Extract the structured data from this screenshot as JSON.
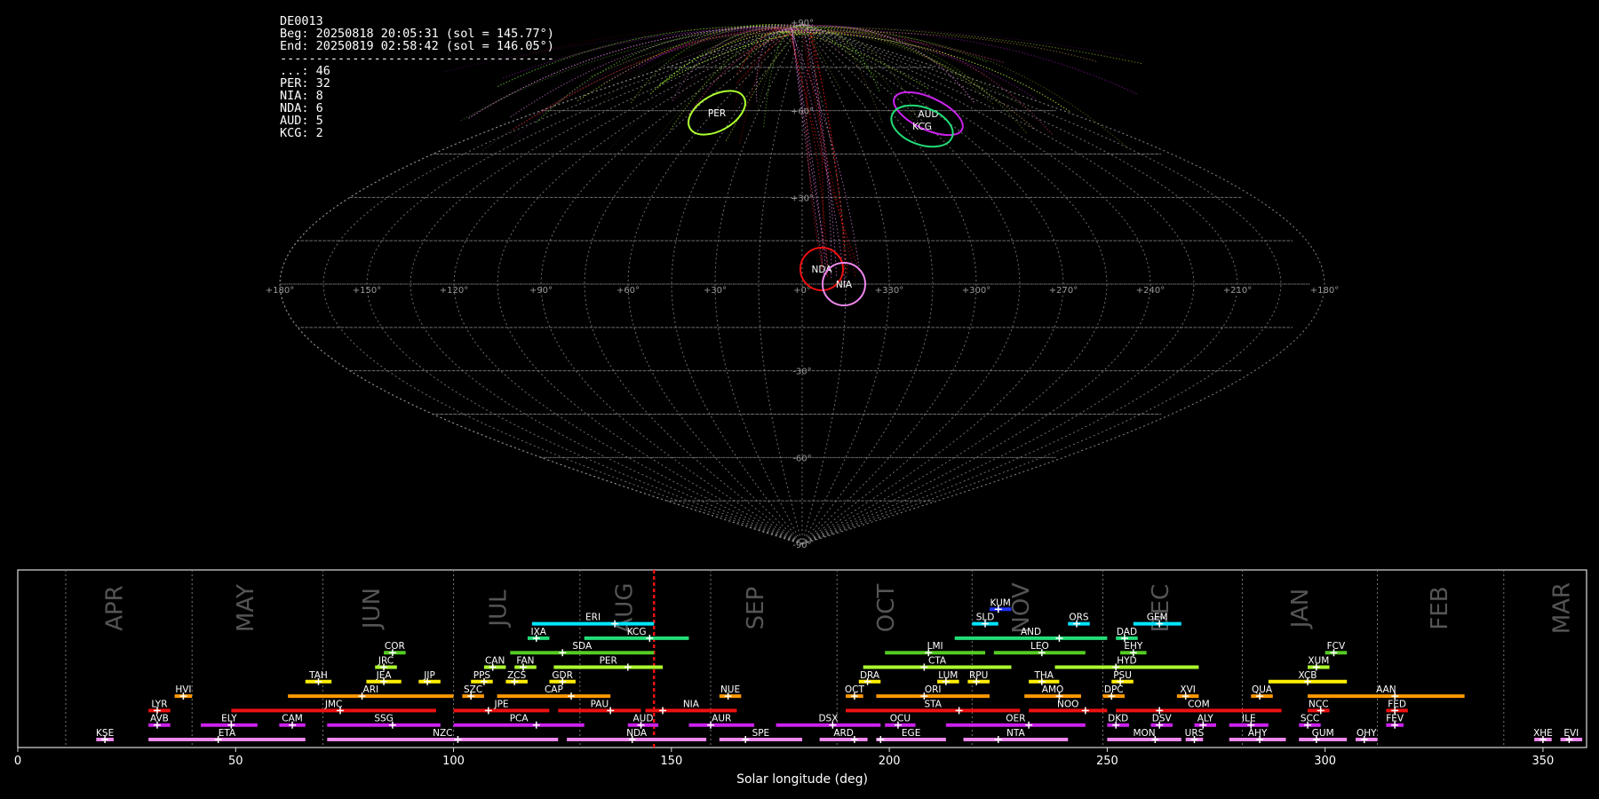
{
  "stats": {
    "camera": "DE0013",
    "begin": "Beg: 20250818 20:05:31 (sol = 145.77°)",
    "end": "End: 20250819 02:58:42 (sol = 146.05°)",
    "separator": "--------------------------------------",
    "counts": [
      {
        "code": "...",
        "n": 46
      },
      {
        "code": "PER",
        "n": 32
      },
      {
        "code": "NIA",
        "n": 8
      },
      {
        "code": "NDA",
        "n": 6
      },
      {
        "code": "AUD",
        "n": 5
      },
      {
        "code": "KCG",
        "n": 2
      }
    ]
  },
  "sky_map": {
    "lon_labels": [
      "+180°",
      "+150°",
      "+120°",
      "+90°",
      "+60°",
      "+30°",
      "+0°",
      "+330°",
      "+300°",
      "+270°",
      "+240°",
      "+210°",
      "+180°"
    ],
    "lat_labels": [
      "+90°",
      "+60°",
      "+30°",
      "-30°",
      "-60°",
      "-90°"
    ],
    "radiants": [
      {
        "code": "PER",
        "lon": 47,
        "lat": 58,
        "color": "#adff2f"
      },
      {
        "code": "AUD",
        "lon": 290,
        "lat": 59,
        "color": "#cc22ee"
      },
      {
        "code": "KCG",
        "lon": 286,
        "lat": 54,
        "color": "#22dd77"
      },
      {
        "code": "NDA",
        "lon": 335,
        "lat": -1,
        "color": "#ee1111"
      },
      {
        "code": "NIA",
        "lon": 323,
        "lat": -3,
        "color": "#ee88ee"
      }
    ]
  },
  "timeline": {
    "xlabel": "Solar longitude (deg)",
    "xticks": [
      0,
      50,
      100,
      150,
      200,
      250,
      300,
      350
    ],
    "xlim": [
      0,
      360
    ],
    "current_sol": 146,
    "months": [
      {
        "name": "APR",
        "pos": 24
      },
      {
        "name": "MAY",
        "pos": 54
      },
      {
        "name": "JUN",
        "pos": 83
      },
      {
        "name": "JUL",
        "pos": 112
      },
      {
        "name": "AUG",
        "pos": 141
      },
      {
        "name": "SEP",
        "pos": 171
      },
      {
        "name": "OCT",
        "pos": 201
      },
      {
        "name": "NOV",
        "pos": 232
      },
      {
        "name": "DEC",
        "pos": 264
      },
      {
        "name": "JAN",
        "pos": 296
      },
      {
        "name": "FEB",
        "pos": 328
      },
      {
        "name": "MAR",
        "pos": 356
      }
    ],
    "month_lines": [
      11,
      40,
      70,
      100,
      129,
      159,
      188,
      219,
      249,
      281,
      312,
      341
    ],
    "showers": [
      {
        "code": "KUM",
        "start": 223,
        "end": 228,
        "peak": 225,
        "row": 9,
        "color": "#2233ff"
      },
      {
        "code": "ERI",
        "start": 118,
        "end": 146,
        "peak": 137,
        "row": 8,
        "color": "#00e5ff"
      },
      {
        "code": "SLD",
        "start": 219,
        "end": 225,
        "peak": 222,
        "row": 8,
        "color": "#00e5ff"
      },
      {
        "code": "ORS",
        "start": 241,
        "end": 246,
        "peak": 243,
        "row": 8,
        "color": "#00e5ff"
      },
      {
        "code": "GEM",
        "start": 256,
        "end": 267,
        "peak": 262,
        "row": 8,
        "color": "#00e5ff"
      },
      {
        "code": "IXA",
        "start": 117,
        "end": 122,
        "peak": 119,
        "row": 7,
        "color": "#22dd77"
      },
      {
        "code": "KCG",
        "start": 130,
        "end": 154,
        "peak": 145,
        "row": 7,
        "color": "#22dd77"
      },
      {
        "code": "AND",
        "start": 215,
        "end": 250,
        "peak": 239,
        "row": 7,
        "color": "#22dd77"
      },
      {
        "code": "DAD",
        "start": 252,
        "end": 257,
        "peak": 254,
        "row": 7,
        "color": "#22dd77"
      },
      {
        "code": "COR",
        "start": 84,
        "end": 89,
        "peak": 86,
        "row": 6,
        "color": "#55cc22"
      },
      {
        "code": "SDA",
        "start": 113,
        "end": 146,
        "peak": 125,
        "row": 6,
        "color": "#55cc22"
      },
      {
        "code": "LMI",
        "start": 199,
        "end": 222,
        "peak": 209,
        "row": 6,
        "color": "#55cc22"
      },
      {
        "code": "LEO",
        "start": 224,
        "end": 245,
        "peak": 235,
        "row": 6,
        "color": "#55cc22"
      },
      {
        "code": "EHY",
        "start": 253,
        "end": 259,
        "peak": 256,
        "row": 6,
        "color": "#55cc22"
      },
      {
        "code": "FCV",
        "start": 300,
        "end": 305,
        "peak": 302,
        "row": 6,
        "color": "#55cc22"
      },
      {
        "code": "JRC",
        "start": 82,
        "end": 87,
        "peak": 84,
        "row": 5,
        "color": "#adff2f"
      },
      {
        "code": "CAN",
        "start": 107,
        "end": 112,
        "peak": 109,
        "row": 5,
        "color": "#adff2f"
      },
      {
        "code": "FAN",
        "start": 114,
        "end": 119,
        "peak": 116,
        "row": 5,
        "color": "#adff2f"
      },
      {
        "code": "PER",
        "start": 123,
        "end": 148,
        "peak": 140,
        "row": 5,
        "color": "#adff2f"
      },
      {
        "code": "CTA",
        "start": 194,
        "end": 228,
        "peak": 208,
        "row": 5,
        "color": "#adff2f"
      },
      {
        "code": "HYD",
        "start": 238,
        "end": 271,
        "peak": 252,
        "row": 5,
        "color": "#adff2f"
      },
      {
        "code": "XUM",
        "start": 296,
        "end": 301,
        "peak": 298,
        "row": 5,
        "color": "#adff2f"
      },
      {
        "code": "TAH",
        "start": 66,
        "end": 72,
        "peak": 69,
        "row": 4,
        "color": "#ffee00"
      },
      {
        "code": "JEA",
        "start": 80,
        "end": 88,
        "peak": 84,
        "row": 4,
        "color": "#ffee00"
      },
      {
        "code": "JIP",
        "start": 92,
        "end": 97,
        "peak": 94,
        "row": 4,
        "color": "#ffee00"
      },
      {
        "code": "PPS",
        "start": 104,
        "end": 109,
        "peak": 107,
        "row": 4,
        "color": "#ffee00"
      },
      {
        "code": "ZCS",
        "start": 112,
        "end": 117,
        "peak": 114,
        "row": 4,
        "color": "#ffee00"
      },
      {
        "code": "GDR",
        "start": 122,
        "end": 128,
        "peak": 125,
        "row": 4,
        "color": "#ffee00"
      },
      {
        "code": "DRA",
        "start": 193,
        "end": 198,
        "peak": 195,
        "row": 4,
        "color": "#ffee00"
      },
      {
        "code": "LUM",
        "start": 211,
        "end": 216,
        "peak": 213,
        "row": 4,
        "color": "#ffee00"
      },
      {
        "code": "RPU",
        "start": 218,
        "end": 223,
        "peak": 220,
        "row": 4,
        "color": "#ffee00"
      },
      {
        "code": "THA",
        "start": 232,
        "end": 239,
        "peak": 235,
        "row": 4,
        "color": "#ffee00"
      },
      {
        "code": "PSU",
        "start": 251,
        "end": 256,
        "peak": 253,
        "row": 4,
        "color": "#ffee00"
      },
      {
        "code": "XCB",
        "start": 287,
        "end": 305,
        "peak": 296,
        "row": 4,
        "color": "#ffee00"
      },
      {
        "code": "HVI",
        "start": 36,
        "end": 40,
        "peak": 38,
        "row": 3,
        "color": "#ff9900"
      },
      {
        "code": "ARI",
        "start": 62,
        "end": 100,
        "peak": 79,
        "row": 3,
        "color": "#ff9900"
      },
      {
        "code": "SZC",
        "start": 102,
        "end": 107,
        "peak": 104,
        "row": 3,
        "color": "#ff9900"
      },
      {
        "code": "CAP",
        "start": 110,
        "end": 136,
        "peak": 127,
        "row": 3,
        "color": "#ff9900"
      },
      {
        "code": "NUE",
        "start": 161,
        "end": 166,
        "peak": 163,
        "row": 3,
        "color": "#ff9900"
      },
      {
        "code": "OCT",
        "start": 190,
        "end": 194,
        "peak": 192,
        "row": 3,
        "color": "#ff9900"
      },
      {
        "code": "ORI",
        "start": 197,
        "end": 223,
        "peak": 208,
        "row": 3,
        "color": "#ff9900"
      },
      {
        "code": "AMO",
        "start": 231,
        "end": 244,
        "peak": 239,
        "row": 3,
        "color": "#ff9900"
      },
      {
        "code": "DPC",
        "start": 249,
        "end": 254,
        "peak": 251,
        "row": 3,
        "color": "#ff9900"
      },
      {
        "code": "XVI",
        "start": 266,
        "end": 271,
        "peak": 268,
        "row": 3,
        "color": "#ff9900"
      },
      {
        "code": "QUA",
        "start": 283,
        "end": 288,
        "peak": 285,
        "row": 3,
        "color": "#ff9900"
      },
      {
        "code": "AAN",
        "start": 296,
        "end": 332,
        "peak": 316,
        "row": 3,
        "color": "#ff9900"
      },
      {
        "code": "LYR",
        "start": 30,
        "end": 35,
        "peak": 32,
        "row": 2,
        "color": "#ee1111"
      },
      {
        "code": "JMC",
        "start": 49,
        "end": 96,
        "peak": 74,
        "row": 2,
        "color": "#ee1111"
      },
      {
        "code": "JPE",
        "start": 100,
        "end": 122,
        "peak": 108,
        "row": 2,
        "color": "#ee1111"
      },
      {
        "code": "PAU",
        "start": 124,
        "end": 143,
        "peak": 136,
        "row": 2,
        "color": "#ee1111"
      },
      {
        "code": "NIA",
        "start": 144,
        "end": 165,
        "peak": 148,
        "row": 2,
        "color": "#ee1111"
      },
      {
        "code": "STA",
        "start": 190,
        "end": 230,
        "peak": 216,
        "row": 2,
        "color": "#ee1111"
      },
      {
        "code": "NOO",
        "start": 232,
        "end": 250,
        "peak": 245,
        "row": 2,
        "color": "#ee1111"
      },
      {
        "code": "COM",
        "start": 252,
        "end": 290,
        "peak": 262,
        "row": 2,
        "color": "#ee1111"
      },
      {
        "code": "NCC",
        "start": 296,
        "end": 301,
        "peak": 299,
        "row": 2,
        "color": "#ee1111"
      },
      {
        "code": "FED",
        "start": 314,
        "end": 319,
        "peak": 316,
        "row": 2,
        "color": "#ee1111"
      },
      {
        "code": "AVB",
        "start": 30,
        "end": 35,
        "peak": 32,
        "row": 1,
        "color": "#cc22ee"
      },
      {
        "code": "ELY",
        "start": 42,
        "end": 55,
        "peak": 49,
        "row": 1,
        "color": "#cc22ee"
      },
      {
        "code": "CAM",
        "start": 60,
        "end": 66,
        "peak": 63,
        "row": 1,
        "color": "#cc22ee"
      },
      {
        "code": "SSG",
        "start": 71,
        "end": 97,
        "peak": 86,
        "row": 1,
        "color": "#cc22ee"
      },
      {
        "code": "PCA",
        "start": 100,
        "end": 130,
        "peak": 119,
        "row": 1,
        "color": "#cc22ee"
      },
      {
        "code": "AUD",
        "start": 140,
        "end": 147,
        "peak": 143,
        "row": 1,
        "color": "#cc22ee"
      },
      {
        "code": "AUR",
        "start": 154,
        "end": 169,
        "peak": 159,
        "row": 1,
        "color": "#cc22ee"
      },
      {
        "code": "DSX",
        "start": 174,
        "end": 198,
        "peak": 187,
        "row": 1,
        "color": "#cc22ee"
      },
      {
        "code": "OCU",
        "start": 199,
        "end": 206,
        "peak": 202,
        "row": 1,
        "color": "#cc22ee"
      },
      {
        "code": "OER",
        "start": 213,
        "end": 245,
        "peak": 232,
        "row": 1,
        "color": "#cc22ee"
      },
      {
        "code": "DKD",
        "start": 250,
        "end": 255,
        "peak": 252,
        "row": 1,
        "color": "#cc22ee"
      },
      {
        "code": "DSV",
        "start": 260,
        "end": 265,
        "peak": 262,
        "row": 1,
        "color": "#cc22ee"
      },
      {
        "code": "ALY",
        "start": 270,
        "end": 275,
        "peak": 272,
        "row": 1,
        "color": "#cc22ee"
      },
      {
        "code": "ILE",
        "start": 278,
        "end": 287,
        "peak": 283,
        "row": 1,
        "color": "#cc22ee"
      },
      {
        "code": "SCC",
        "start": 294,
        "end": 299,
        "peak": 296,
        "row": 1,
        "color": "#cc22ee"
      },
      {
        "code": "FEV",
        "start": 314,
        "end": 318,
        "peak": 316,
        "row": 1,
        "color": "#cc22ee"
      },
      {
        "code": "KSE",
        "start": 18,
        "end": 22,
        "peak": 20,
        "row": 0,
        "color": "#ee88ee"
      },
      {
        "code": "ETA",
        "start": 30,
        "end": 66,
        "peak": 46,
        "row": 0,
        "color": "#ee88ee"
      },
      {
        "code": "NZC",
        "start": 71,
        "end": 124,
        "peak": 101,
        "row": 0,
        "color": "#ee88ee"
      },
      {
        "code": "NDA",
        "start": 126,
        "end": 158,
        "peak": 141,
        "row": 0,
        "color": "#ee88ee"
      },
      {
        "code": "SPE",
        "start": 161,
        "end": 180,
        "peak": 167,
        "row": 0,
        "color": "#ee88ee"
      },
      {
        "code": "ARD",
        "start": 184,
        "end": 195,
        "peak": 192,
        "row": 0,
        "color": "#ee88ee"
      },
      {
        "code": "EGE",
        "start": 197,
        "end": 213,
        "peak": 198,
        "row": 0,
        "color": "#ee88ee"
      },
      {
        "code": "NTA",
        "start": 217,
        "end": 241,
        "peak": 225,
        "row": 0,
        "color": "#ee88ee"
      },
      {
        "code": "MON",
        "start": 250,
        "end": 267,
        "peak": 261,
        "row": 0,
        "color": "#ee88ee"
      },
      {
        "code": "URS",
        "start": 268,
        "end": 272,
        "peak": 270,
        "row": 0,
        "color": "#ee88ee"
      },
      {
        "code": "AHY",
        "start": 278,
        "end": 291,
        "peak": 285,
        "row": 0,
        "color": "#ee88ee"
      },
      {
        "code": "GUM",
        "start": 294,
        "end": 305,
        "peak": 298,
        "row": 0,
        "color": "#ee88ee"
      },
      {
        "code": "OHY",
        "start": 307,
        "end": 312,
        "peak": 309,
        "row": 0,
        "color": "#ee88ee"
      },
      {
        "code": "XHE",
        "start": 348,
        "end": 352,
        "peak": 350,
        "row": 0,
        "color": "#ee88ee"
      },
      {
        "code": "EVI",
        "start": 354,
        "end": 359,
        "peak": 356,
        "row": 0,
        "color": "#ee88ee"
      }
    ]
  }
}
